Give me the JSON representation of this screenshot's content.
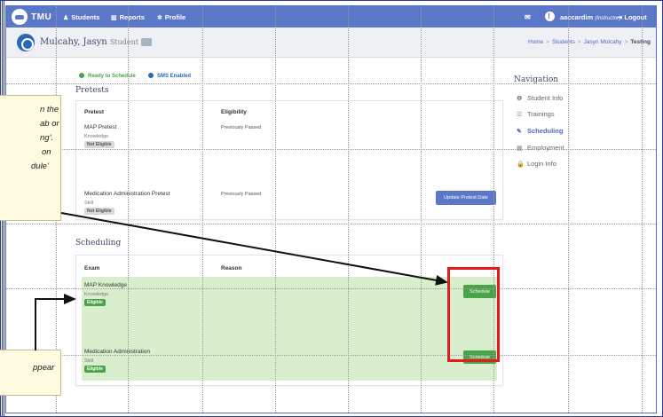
{
  "topbar": {
    "brand": "TMU",
    "nav": [
      {
        "icon": "user-icon",
        "glyph": "♟",
        "label": "Students"
      },
      {
        "icon": "bar-chart-icon",
        "glyph": "▥",
        "label": "Reports"
      },
      {
        "icon": "gear-icon",
        "glyph": "✲",
        "label": "Profile"
      }
    ],
    "username": "aaccardim",
    "user_role": "(Instructor)",
    "logout_label": "Logout"
  },
  "student": {
    "name": "Mulcahy, Jasyn",
    "role": "Student"
  },
  "breadcrumb": [
    "Home",
    "Students",
    "Jasyn Mulcahy",
    "Testing"
  ],
  "status": {
    "ready": "Ready to Schedule",
    "ready_color": "#4aa24a",
    "sms": "SMS Enabled",
    "sms_color": "#2a68b8"
  },
  "pretests": {
    "title": "Pretests",
    "headers": {
      "pretest": "Pretest",
      "eligibility": "Eligibility"
    },
    "rows": [
      {
        "name": "MAP Pretest",
        "type": "Knowledge",
        "badge": "Not Eligible",
        "eligibility": "Previously Passed"
      },
      {
        "name": "Medication Administration Pretest",
        "type": "Skill",
        "badge": "Not Eligible",
        "eligibility": "Previously Passed",
        "action": "Update Pretest Date"
      }
    ]
  },
  "scheduling": {
    "title": "Scheduling",
    "headers": {
      "exam": "Exam",
      "reason": "Reason"
    },
    "rows": [
      {
        "name": "MAP Knowledge",
        "type": "Knowledge",
        "badge": "Eligible",
        "action": "Schedule"
      },
      {
        "name": "Medication Administration",
        "type": "Skill",
        "badge": "Eligible",
        "action": "Schedule"
      }
    ]
  },
  "navigation": {
    "title": "Navigation",
    "items": [
      {
        "icon": "info-icon",
        "glyph": "❶",
        "label": "Student Info"
      },
      {
        "icon": "list-icon",
        "glyph": "☰",
        "label": "Trainings"
      },
      {
        "icon": "edit-icon",
        "glyph": "✎",
        "label": "Scheduling",
        "active": true
      },
      {
        "icon": "building-icon",
        "glyph": "▦",
        "label": "Employment"
      },
      {
        "icon": "lock-icon",
        "glyph": "🔒",
        "label": "Login Info"
      }
    ]
  },
  "callouts": {
    "top_lines": [
      "n the",
      "ab or",
      "ng’.",
      "on",
      "dule’"
    ],
    "bottom_lines": [
      "ppear"
    ]
  }
}
